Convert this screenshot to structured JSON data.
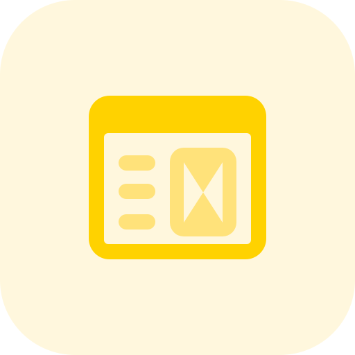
{
  "icon": {
    "name": "browser-window-layout-icon",
    "colors": {
      "background": "#FFF7DD",
      "frame": "#FFD200",
      "accent": "#FFE27A",
      "window_fill": "#FFF7DD"
    },
    "content_lines": 3
  }
}
